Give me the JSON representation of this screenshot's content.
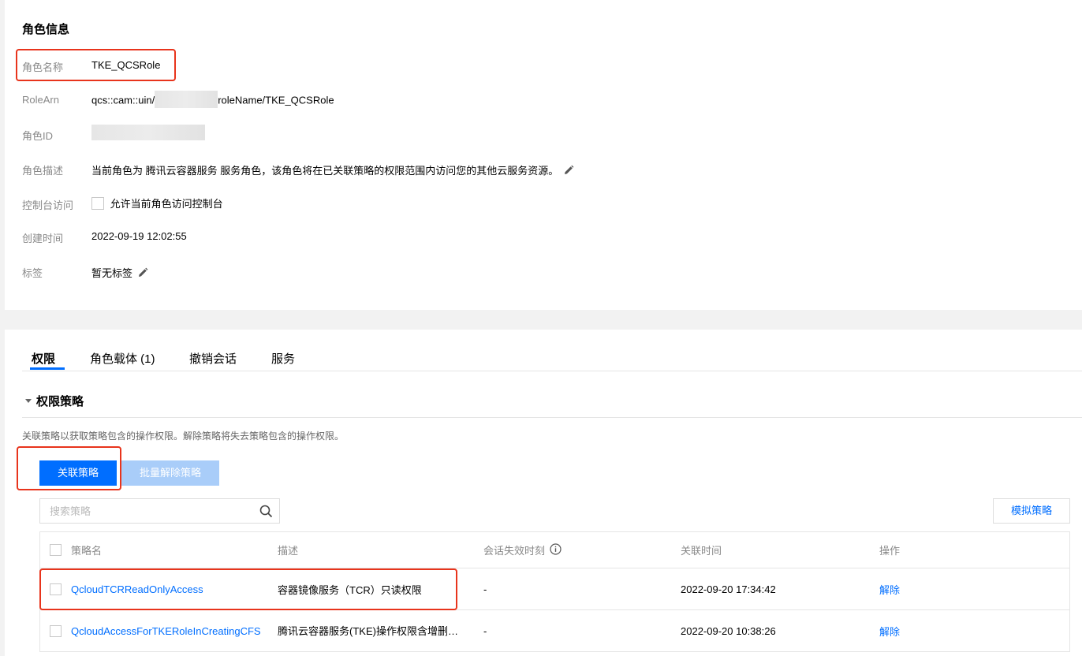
{
  "role_info": {
    "title": "角色信息",
    "rows": {
      "name": {
        "label": "角色名称",
        "value": "TKE_QCSRole"
      },
      "arn": {
        "label": "RoleArn",
        "value_prefix": "qcs::cam::uin/",
        "value_suffix": "roleName/TKE_QCSRole"
      },
      "id": {
        "label": "角色ID"
      },
      "description": {
        "label": "角色描述",
        "value": "当前角色为 腾讯云容器服务 服务角色，该角色将在已关联策略的权限范围内访问您的其他云服务资源。"
      },
      "console_access": {
        "label": "控制台访问",
        "checkbox_label": "允许当前角色访问控制台"
      },
      "created": {
        "label": "创建时间",
        "value": "2022-09-19 12:02:55"
      },
      "tags": {
        "label": "标签",
        "value": "暂无标签"
      }
    }
  },
  "tabs": [
    {
      "label": "权限",
      "active": true
    },
    {
      "label": "角色载体 (1)",
      "active": false
    },
    {
      "label": "撤销会话",
      "active": false
    },
    {
      "label": "服务",
      "active": false
    }
  ],
  "permissions": {
    "section_title": "权限策略",
    "help_text": "关联策略以获取策略包含的操作权限。解除策略将失去策略包含的操作权限。",
    "attach_button": "关联策略",
    "batch_detach_button": "批量解除策略",
    "search_placeholder": "搜索策略",
    "simulate_button": "模拟策略",
    "columns": {
      "name": "策略名",
      "desc": "描述",
      "session": "会话失效时刻",
      "time": "关联时间",
      "op": "操作"
    },
    "rows": [
      {
        "name": "QcloudTCRReadOnlyAccess",
        "desc": "容器镜像服务（TCR）只读权限",
        "session": "-",
        "time": "2022-09-20 17:34:42",
        "op": "解除"
      },
      {
        "name": "QcloudAccessForTKERoleInCreatingCFS",
        "desc": "腾讯云容器服务(TKE)操作权限含增删改查",
        "session": "-",
        "time": "2022-09-20 10:38:26",
        "op": "解除"
      }
    ]
  },
  "colors": {
    "accent": "#006eff",
    "highlight_box": "#e8341c",
    "disabled_button": "#a9cdf9"
  }
}
